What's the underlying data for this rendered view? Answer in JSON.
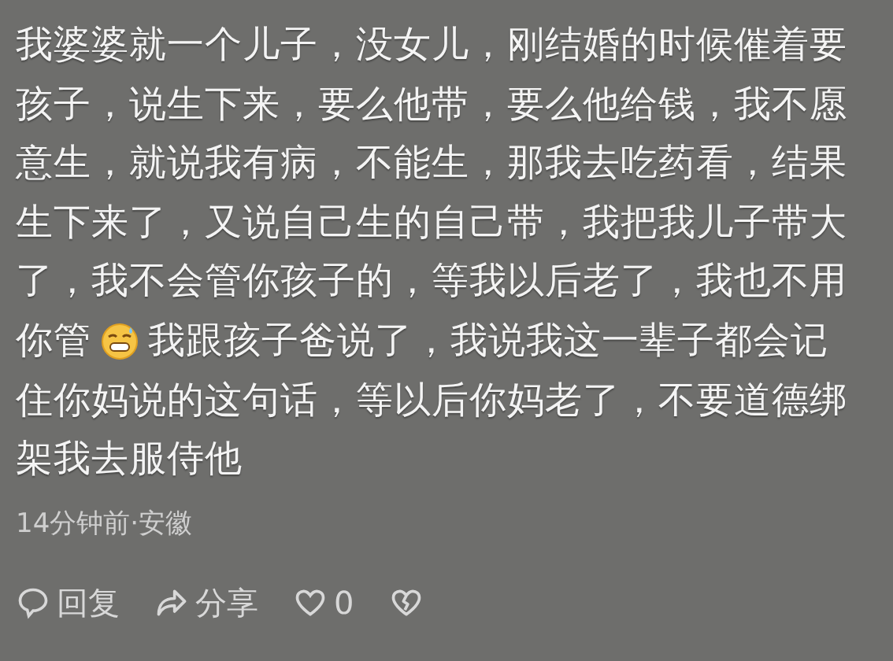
{
  "comment": {
    "lines": [
      {
        "parts": [
          {
            "kind": "text",
            "text": "我婆婆就一个儿子，没女儿，刚结婚的时候催着要"
          }
        ]
      },
      {
        "parts": [
          {
            "kind": "text",
            "text": "孩子，说生下来，要么他带，要么他给钱，我不愿"
          }
        ]
      },
      {
        "parts": [
          {
            "kind": "text",
            "text": "意生，就说我有病，不能生，那我去吃药看，结果"
          }
        ]
      },
      {
        "parts": [
          {
            "kind": "text",
            "text": "生下来了，又说自己生的自己带，我把我儿子带大"
          }
        ]
      },
      {
        "parts": [
          {
            "kind": "text",
            "text": "了，我不会管你孩子的，等我以后老了，我也不用"
          }
        ]
      },
      {
        "parts": [
          {
            "kind": "text",
            "text": "你管"
          },
          {
            "kind": "emoji"
          },
          {
            "kind": "text",
            "text": "我跟孩子爸说了，我说我这一辈子都会记"
          }
        ]
      },
      {
        "parts": [
          {
            "kind": "text",
            "text": "住你妈说的这句话，等以后你妈老了，不要道德绑"
          }
        ]
      },
      {
        "parts": [
          {
            "kind": "text",
            "text": "架我去服侍他"
          }
        ]
      }
    ],
    "meta": "14分钟前·安徽",
    "actions": [
      {
        "kind": "reply",
        "label": "回复"
      },
      {
        "kind": "share",
        "label": "分享"
      },
      {
        "kind": "like",
        "label": "0"
      },
      {
        "kind": "dislike"
      }
    ]
  }
}
